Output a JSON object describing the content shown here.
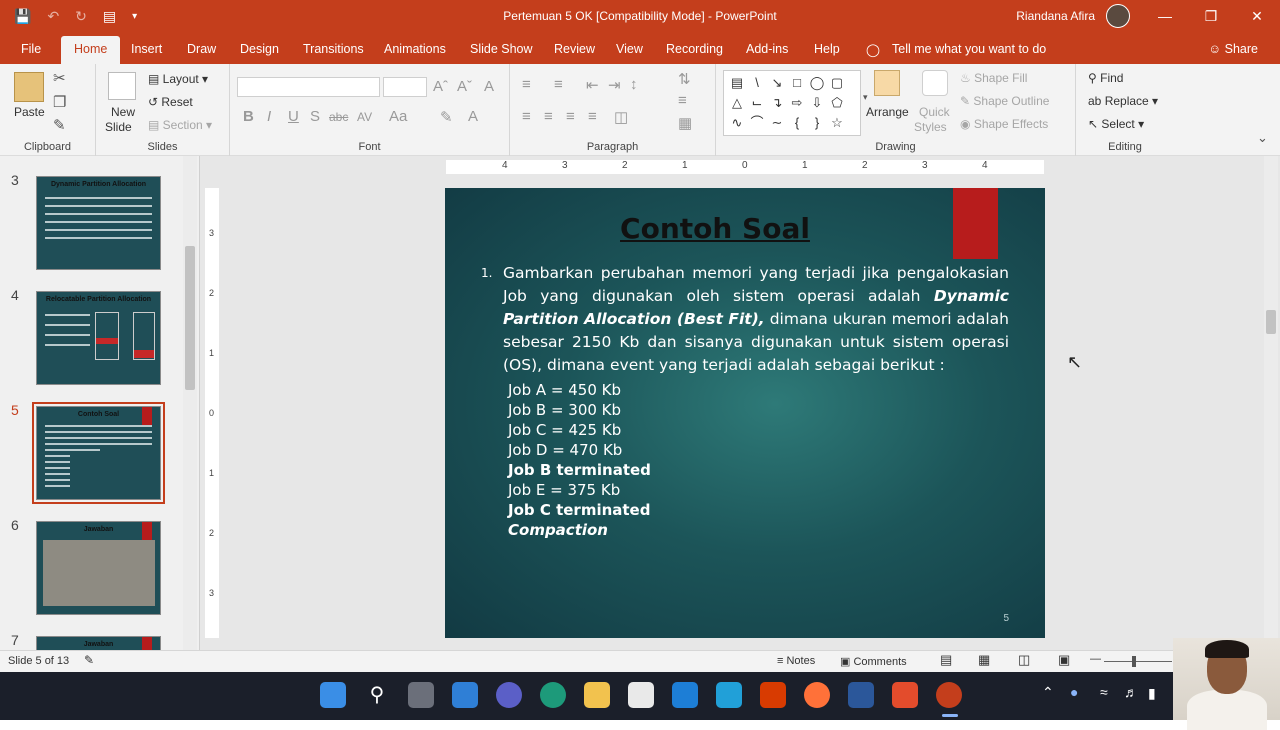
{
  "window": {
    "title": "Pertemuan 5 OK [Compatibility Mode]  -  PowerPoint",
    "user": "Riandana Afira"
  },
  "tabs": [
    "File",
    "Home",
    "Insert",
    "Draw",
    "Design",
    "Transitions",
    "Animations",
    "Slide Show",
    "Review",
    "View",
    "Recording",
    "Add-ins",
    "Help"
  ],
  "tell_me": "Tell me what you want to do",
  "share": "Share",
  "ribbon": {
    "clipboard": {
      "paste": "Paste",
      "label": "Clipboard"
    },
    "slides": {
      "new_slide_1": "New",
      "new_slide_2": "Slide",
      "layout": "Layout",
      "reset": "Reset",
      "section": "Section",
      "label": "Slides"
    },
    "font": {
      "label": "Font"
    },
    "paragraph": {
      "label": "Paragraph"
    },
    "drawing": {
      "arrange": "Arrange",
      "quick_1": "Quick",
      "quick_2": "Styles",
      "shape_fill": "Shape Fill",
      "shape_outline": "Shape Outline",
      "shape_effects": "Shape Effects",
      "label": "Drawing"
    },
    "editing": {
      "find": "Find",
      "replace": "Replace",
      "select": "Select",
      "label": "Editing"
    }
  },
  "thumbnails": [
    {
      "num": "3",
      "title": "Dynamic Partition Allocation"
    },
    {
      "num": "4",
      "title": "Relocatable Partition Allocation"
    },
    {
      "num": "5",
      "title": "Contoh Soal"
    },
    {
      "num": "6",
      "title": "Jawaban"
    },
    {
      "num": "7",
      "title": "Jawaban"
    }
  ],
  "slide": {
    "title": "Contoh Soal",
    "item_number": "1.",
    "para_a": "Gambarkan perubahan memori yang terjadi jika pengalokasian Job yang digunakan oleh sistem operasi adalah ",
    "para_b": "Dynamic Partition Allocation (Best Fit),",
    "para_c": " dimana ukuran memori adalah sebesar 2150 Kb dan sisanya digunakan untuk sistem operasi (OS), dimana event yang terjadi adalah sebagai berikut :",
    "jobs": [
      "Job A = 450 Kb",
      "Job B = 300 Kb",
      "Job C = 425 Kb",
      "Job D = 470 Kb",
      "Job B terminated",
      "Job E = 375 Kb",
      "Job C terminated",
      "Compaction"
    ],
    "page_number": "5"
  },
  "ruler": {
    "h": [
      "4",
      "3",
      "2",
      "1",
      "0",
      "1",
      "2",
      "3",
      "4"
    ],
    "v": [
      "3",
      "2",
      "1",
      "0",
      "1",
      "2",
      "3"
    ]
  },
  "status": {
    "slide_count": "Slide 5 of 13",
    "notes": "Notes",
    "comments": "Comments"
  }
}
